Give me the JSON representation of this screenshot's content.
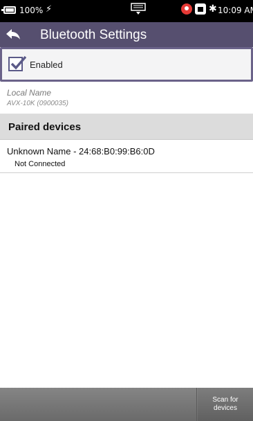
{
  "status_bar": {
    "battery_percent": "100%",
    "time": "10:09 AM",
    "icons": [
      "battery-icon",
      "charging-bolt-icon",
      "keyboard-icon",
      "location-pin-icon",
      "usb-icon",
      "bluetooth-icon"
    ]
  },
  "title_bar": {
    "title": "Bluetooth Settings",
    "color": "#564f6f"
  },
  "enabled": {
    "label": "Enabled",
    "checked": true
  },
  "local_name": {
    "label": "Local Name",
    "value": "AVX-10K (0900035)"
  },
  "paired": {
    "header": "Paired devices",
    "devices": [
      {
        "name": "Unknown Name - 24:68:B0:99:B6:0D",
        "status": "Not Connected"
      }
    ]
  },
  "bottom_bar": {
    "scan_label": "Scan for devices"
  }
}
